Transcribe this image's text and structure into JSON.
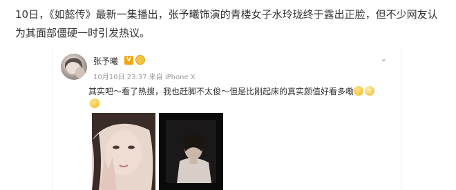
{
  "article": {
    "paragraph": "10日，《如懿传》最新一集播出，张予曦饰演的青楼女子水玲珑终于露出正脸，但不少网友认为其面部僵硬一时引发热议。"
  },
  "weibo_post": {
    "username": "张予曦",
    "verified_mark": "V",
    "timestamp": "10月10日 23:37",
    "source": "来自 iPhone X",
    "text": "其实吧～看了热搜，我也赶脚不太俊～但是比刚起床的真实颜值好看多嘞",
    "icons": [
      "avatar",
      "verified-badge",
      "member-badge-icon",
      "chevron-down-icon",
      "emoji-icon"
    ]
  },
  "colors": {
    "verified": "#f2a60b",
    "meta_text": "#999999",
    "body_text": "#333333"
  }
}
